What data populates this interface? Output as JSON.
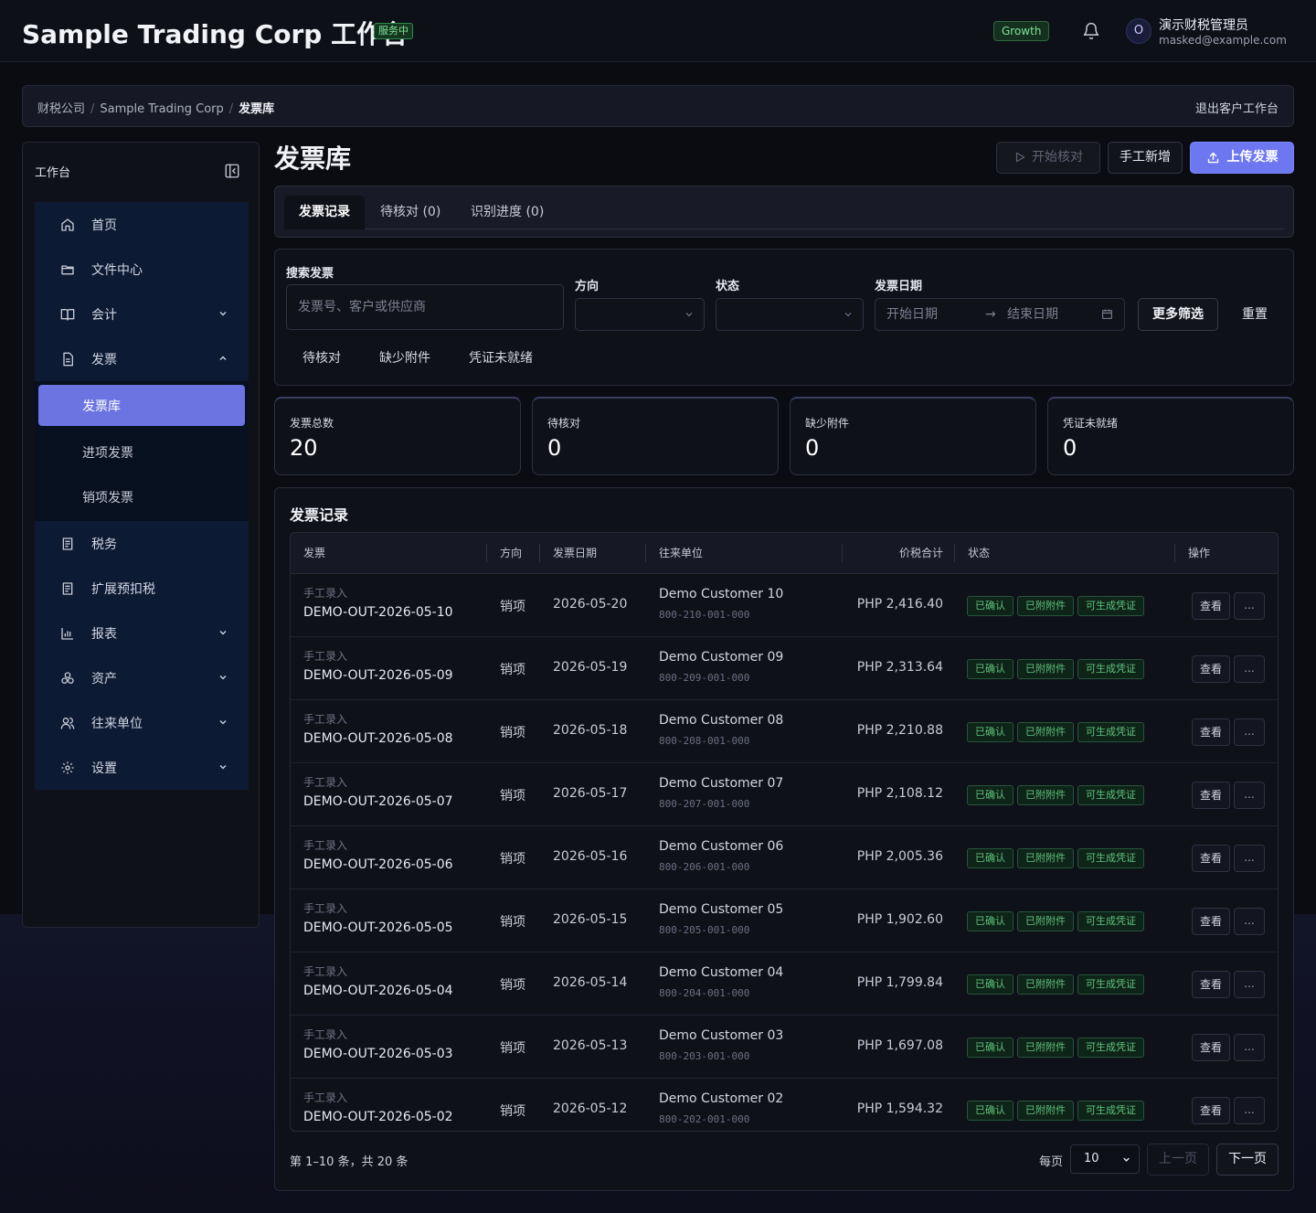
{
  "header": {
    "title": "Sample Trading Corp 工作台",
    "service_badge": "服务中",
    "plan_badge": "Growth",
    "user_initial": "O",
    "user_name": "演示财税管理员",
    "user_email": "masked@example.com"
  },
  "breadcrumb": {
    "items": [
      "财税公司",
      "Sample Trading Corp",
      "发票库"
    ],
    "exit_label": "退出客户工作台"
  },
  "sidebar": {
    "title": "工作台",
    "items": [
      {
        "label": "首页",
        "icon": "home-icon"
      },
      {
        "label": "文件中心",
        "icon": "folder-icon"
      },
      {
        "label": "会计",
        "icon": "book-icon"
      },
      {
        "label": "发票",
        "icon": "document-icon"
      },
      {
        "label": "税务",
        "icon": "receipt-icon"
      },
      {
        "label": "扩展预扣税",
        "icon": "receipt-icon"
      },
      {
        "label": "报表",
        "icon": "bar-chart-icon"
      },
      {
        "label": "资产",
        "icon": "boxes-icon"
      },
      {
        "label": "往来单位",
        "icon": "users-icon"
      },
      {
        "label": "设置",
        "icon": "gear-icon"
      }
    ],
    "invoice_submenu": [
      "发票库",
      "进项发票",
      "销项发票"
    ]
  },
  "page": {
    "title": "发票库",
    "btn_start_review": "开始核对",
    "btn_manual_add": "手工新增",
    "btn_upload": "上传发票"
  },
  "tabs": [
    "发票记录",
    "待核对 (0)",
    "识别进度 (0)"
  ],
  "filters": {
    "search_label": "搜索发票",
    "search_placeholder": "发票号、客户或供应商",
    "direction_label": "方向",
    "status_label": "状态",
    "date_label": "发票日期",
    "start_date_placeholder": "开始日期",
    "end_date_placeholder": "结束日期",
    "more_filters": "更多筛选",
    "reset": "重置",
    "quick": [
      "待核对",
      "缺少附件",
      "凭证未就绪"
    ]
  },
  "stats": [
    {
      "label": "发票总数",
      "value": "20"
    },
    {
      "label": "待核对",
      "value": "0"
    },
    {
      "label": "缺少附件",
      "value": "0"
    },
    {
      "label": "凭证未就绪",
      "value": "0"
    }
  ],
  "table": {
    "title": "发票记录",
    "columns": [
      "发票",
      "方向",
      "发票日期",
      "往来单位",
      "价税合计",
      "状态",
      "操作"
    ],
    "view_label": "查看",
    "more_label": "...",
    "rows": [
      {
        "source": "手工录入",
        "number": "DEMO-OUT-2026-05-10",
        "direction": "销项",
        "date": "2026-05-20",
        "customer": "Demo Customer 10",
        "tin": "800-210-001-000",
        "amount": "PHP 2,416.40",
        "tags": [
          "已确认",
          "已附附件",
          "可生成凭证"
        ]
      },
      {
        "source": "手工录入",
        "number": "DEMO-OUT-2026-05-09",
        "direction": "销项",
        "date": "2026-05-19",
        "customer": "Demo Customer 09",
        "tin": "800-209-001-000",
        "amount": "PHP 2,313.64",
        "tags": [
          "已确认",
          "已附附件",
          "可生成凭证"
        ]
      },
      {
        "source": "手工录入",
        "number": "DEMO-OUT-2026-05-08",
        "direction": "销项",
        "date": "2026-05-18",
        "customer": "Demo Customer 08",
        "tin": "800-208-001-000",
        "amount": "PHP 2,210.88",
        "tags": [
          "已确认",
          "已附附件",
          "可生成凭证"
        ]
      },
      {
        "source": "手工录入",
        "number": "DEMO-OUT-2026-05-07",
        "direction": "销项",
        "date": "2026-05-17",
        "customer": "Demo Customer 07",
        "tin": "800-207-001-000",
        "amount": "PHP 2,108.12",
        "tags": [
          "已确认",
          "已附附件",
          "可生成凭证"
        ]
      },
      {
        "source": "手工录入",
        "number": "DEMO-OUT-2026-05-06",
        "direction": "销项",
        "date": "2026-05-16",
        "customer": "Demo Customer 06",
        "tin": "800-206-001-000",
        "amount": "PHP 2,005.36",
        "tags": [
          "已确认",
          "已附附件",
          "可生成凭证"
        ]
      },
      {
        "source": "手工录入",
        "number": "DEMO-OUT-2026-05-05",
        "direction": "销项",
        "date": "2026-05-15",
        "customer": "Demo Customer 05",
        "tin": "800-205-001-000",
        "amount": "PHP 1,902.60",
        "tags": [
          "已确认",
          "已附附件",
          "可生成凭证"
        ]
      },
      {
        "source": "手工录入",
        "number": "DEMO-OUT-2026-05-04",
        "direction": "销项",
        "date": "2026-05-14",
        "customer": "Demo Customer 04",
        "tin": "800-204-001-000",
        "amount": "PHP 1,799.84",
        "tags": [
          "已确认",
          "已附附件",
          "可生成凭证"
        ]
      },
      {
        "source": "手工录入",
        "number": "DEMO-OUT-2026-05-03",
        "direction": "销项",
        "date": "2026-05-13",
        "customer": "Demo Customer 03",
        "tin": "800-203-001-000",
        "amount": "PHP 1,697.08",
        "tags": [
          "已确认",
          "已附附件",
          "可生成凭证"
        ]
      },
      {
        "source": "手工录入",
        "number": "DEMO-OUT-2026-05-02",
        "direction": "销项",
        "date": "2026-05-12",
        "customer": "Demo Customer 02",
        "tin": "800-202-001-000",
        "amount": "PHP 1,594.32",
        "tags": [
          "已确认",
          "已附附件",
          "可生成凭证"
        ]
      }
    ]
  },
  "pagination": {
    "summary": "第 1–10 条，共 20 条",
    "per_page_label": "每页",
    "per_page_value": "10",
    "prev": "上一页",
    "next": "下一页"
  },
  "colors": {
    "accent": "#6b74e0",
    "success": "#5ec27c",
    "background": "#0b0c12"
  }
}
